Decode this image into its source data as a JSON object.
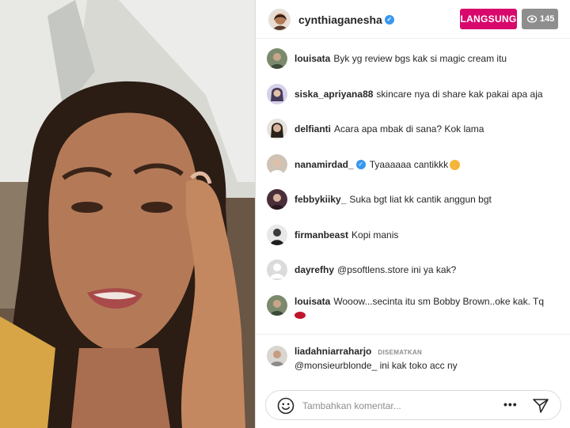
{
  "header": {
    "host_username": "cynthiaganesha",
    "host_verified": true,
    "live_label": "LANGSUNG",
    "viewer_count": "145"
  },
  "comments": [
    {
      "user": "louisata",
      "text": "Byk yg review bgs kak si magic cream itu"
    },
    {
      "user": "siska_apriyana88",
      "text": "skincare nya di share kak pakai apa aja"
    },
    {
      "user": "delfianti",
      "text": "Acara apa mbak di sana? Kok lama"
    },
    {
      "user": "nanamirdad_",
      "verified": true,
      "text": "Tyaaaaaa cantikkk",
      "emoji": "smiling-face-emoji"
    },
    {
      "user": "febbykiiky_",
      "text": "Suka bgt liat kk cantik anggun bgt"
    },
    {
      "user": "firmanbeast",
      "text": "Kopi manis"
    },
    {
      "user": "dayrefhy",
      "text": "@psoftlens.store ini ya kak?"
    },
    {
      "user": "louisata",
      "text": "Wooow...secinta itu sm Bobby Brown..oke kak. Tq",
      "emoji": "lips-emoji"
    }
  ],
  "pinned": {
    "user": "liadahniarraharjo",
    "label": "DISEMATKAN",
    "text": "@monsieurblonde_ ini kak toko acc ny"
  },
  "composer": {
    "placeholder": "Tambahkan komentar...",
    "more_label": "•••"
  },
  "colors": {
    "live": "#d8086c",
    "viewer_badge": "#8e8e8e",
    "verified": "#3897f0",
    "text": "#262626"
  }
}
